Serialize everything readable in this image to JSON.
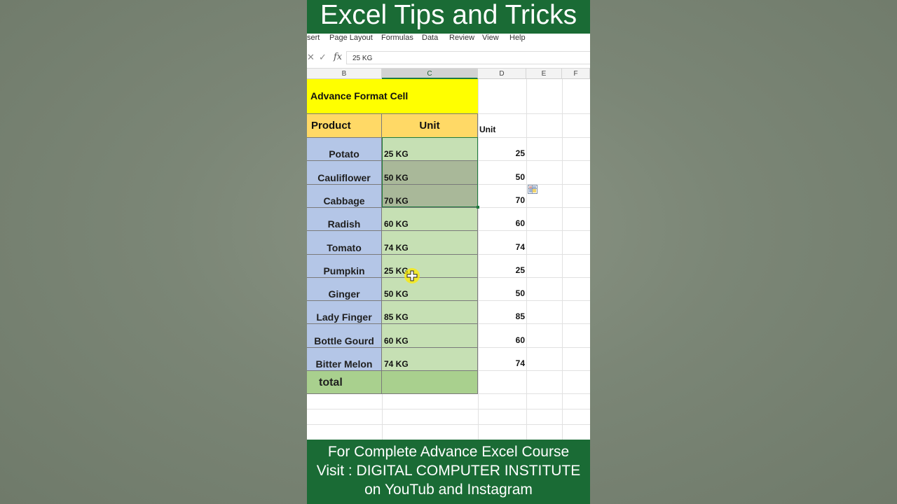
{
  "banner_title": "Excel Tips and Tricks",
  "ribbon": {
    "tabs": [
      "sert",
      "Page Layout",
      "Formulas",
      "Data",
      "Review",
      "View",
      "Help"
    ]
  },
  "formula_bar": {
    "cancel_icon": "close-icon",
    "enter_icon": "check-icon",
    "fx_label": "fx",
    "value": "25 KG"
  },
  "columns": [
    "B",
    "C",
    "D",
    "E",
    "F"
  ],
  "table": {
    "title": "Advance Format Cell",
    "header_product": "Product",
    "header_unit": "Unit",
    "products": [
      "Potato",
      "Cauliflower",
      "Cabbage",
      "Radish",
      "Tomato",
      "Pumpkin",
      "Ginger",
      "Lady Finger",
      "Bottle Gourd",
      "Bitter Melon"
    ],
    "units": [
      "25 KG",
      "50 KG",
      "70 KG",
      "60 KG",
      "74 KG",
      "25 KG",
      "50 KG",
      "85 KG",
      "60 KG",
      "74 KG"
    ],
    "total_label": "total"
  },
  "column_d": {
    "label": "Unit",
    "values": [
      "25",
      "50",
      "70",
      "60",
      "74",
      "25",
      "50",
      "85",
      "60",
      "74"
    ]
  },
  "quick_analysis_icon": "quick-analysis-icon",
  "footer": {
    "line1": "For Complete Advance Excel Course",
    "line2": "Visit : DIGITAL COMPUTER INSTITUTE",
    "line3": "on YouTub and Instagram"
  },
  "colors": {
    "banner": "#1a6b35",
    "title_fill": "#ffff00",
    "header_fill": "#ffd966",
    "product_fill": "#b4c6e7",
    "unit_fill": "#c6e0b4",
    "total_fill": "#a9d08e",
    "selection": "#1f7a3f"
  }
}
